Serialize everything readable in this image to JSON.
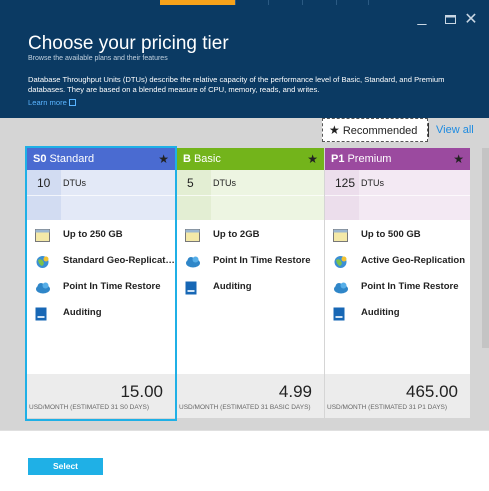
{
  "window": {
    "minimize": "_",
    "maximize": "□",
    "close": "✕"
  },
  "header": {
    "title": "Choose your pricing tier",
    "subtitle": "Browse the available plans and their features",
    "description": "Database Throughput Units (DTUs) describe the relative capacity of the performance level of Basic, Standard, and Premium databases. They are based on a blended measure of CPU, memory, reads, and writes.",
    "learn_more": "Learn more"
  },
  "toolbar": {
    "recommended": "Recommended",
    "view_all": "View all"
  },
  "cards": [
    {
      "code": "S0",
      "name": "Standard",
      "dtu": "10",
      "dtu_label": "DTUs",
      "features": [
        {
          "icon": "storage-icon",
          "label": "Up to 250 GB"
        },
        {
          "icon": "globe-icon",
          "label": "Standard Geo-Replication"
        },
        {
          "icon": "cloud-restore-icon",
          "label": "Point In Time Restore"
        },
        {
          "icon": "auditing-icon",
          "label": "Auditing"
        }
      ],
      "price": "15.00",
      "price_note": "USD/MONTH (ESTIMATED 31 S0 DAYS)",
      "color": "#4a6bd1"
    },
    {
      "code": "B",
      "name": "Basic",
      "dtu": "5",
      "dtu_label": "DTUs",
      "features": [
        {
          "icon": "storage-icon",
          "label": "Up to 2GB"
        },
        {
          "icon": "cloud-restore-icon",
          "label": "Point In Time Restore"
        },
        {
          "icon": "auditing-icon",
          "label": "Auditing"
        }
      ],
      "price": "4.99",
      "price_note": "USD/MONTH (ESTIMATED 31 BASIC DAYS)",
      "color": "#73b41b"
    },
    {
      "code": "P1",
      "name": "Premium",
      "dtu": "125",
      "dtu_label": "DTUs",
      "features": [
        {
          "icon": "storage-icon",
          "label": "Up to 500 GB"
        },
        {
          "icon": "globe-icon",
          "label": "Active Geo-Replication"
        },
        {
          "icon": "cloud-restore-icon",
          "label": "Point In Time Restore"
        },
        {
          "icon": "auditing-icon",
          "label": "Auditing"
        }
      ],
      "price": "465.00",
      "price_note": "USD/MONTH (ESTIMATED 31 P1 DAYS)",
      "color": "#9b4a9f"
    }
  ],
  "footer": {
    "select": "Select"
  },
  "colors": {
    "header_bg": "#0b3a63",
    "accent": "#1fb0e6",
    "tab_accent": "#f7a21a"
  }
}
